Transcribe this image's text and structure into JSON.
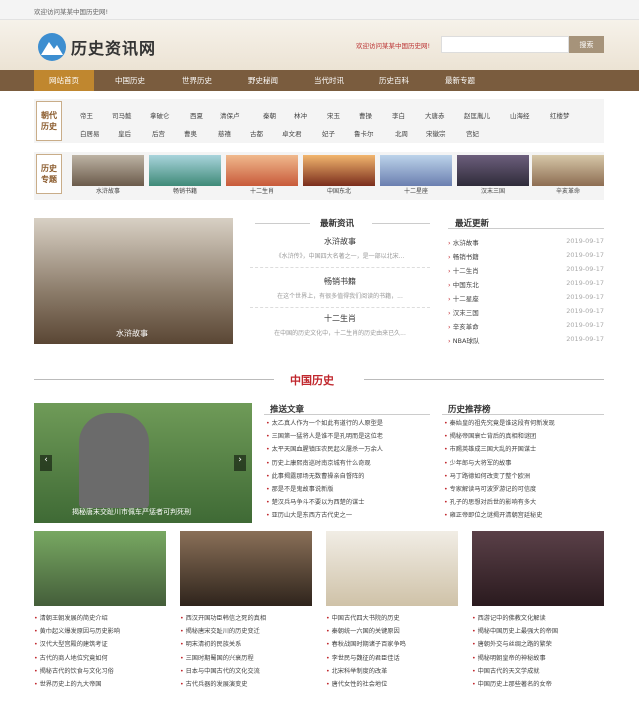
{
  "topbar": {
    "welcome": "欢迎访问某某中国历史网!"
  },
  "header": {
    "logo_text": "历史资讯网",
    "welcome": "欢迎访问某某中国历史网!",
    "search_button": "搜索"
  },
  "nav": {
    "items": [
      "网站首页",
      "中国历史",
      "世界历史",
      "野史秘闻",
      "当代时讯",
      "历史百科",
      "最新专题"
    ]
  },
  "dynasty": {
    "label1": "朝代",
    "label2": "历史",
    "row1": [
      "帝王",
      "司马懿",
      "拿破仑",
      "西夏",
      "清保卢",
      "秦朝",
      "林冲",
      "宋玉",
      "曹操",
      "李白",
      "大唐赤",
      "赵匡胤儿",
      "山海经",
      "红楼梦"
    ],
    "row2": [
      "白居易",
      "皇后",
      "后宫",
      "曹奥",
      "慈禧",
      "古都",
      "卓文君",
      "妃子",
      "鲁卡尔",
      "北周",
      "宋徽宗",
      "宫妃"
    ]
  },
  "topics": {
    "label1": "历史",
    "label2": "专题",
    "items": [
      "水浒故事",
      "畅销书籍",
      "十二生肖",
      "中国东北",
      "十二星座",
      "汉末三国",
      "辛亥革命"
    ]
  },
  "hero": {
    "caption": "水浒故事"
  },
  "news": {
    "title": "最新资讯",
    "items": [
      {
        "title": "水浒故事",
        "desc": "《水浒传》，中国四大名著之一，是一部以北宋..."
      },
      {
        "title": "畅销书籍",
        "desc": "在这个世界上，有很多值得我们阅读的书籍，..."
      },
      {
        "title": "十二生肖",
        "desc": "在中国的历史文化中，十二生肖的历史由来已久..."
      }
    ]
  },
  "latest": {
    "title": "最近更新",
    "items": [
      {
        "t": "水浒故事",
        "d": "2019-09-17"
      },
      {
        "t": "畅销书籍",
        "d": "2019-09-17"
      },
      {
        "t": "十二生肖",
        "d": "2019-09-17"
      },
      {
        "t": "中国东北",
        "d": "2019-09-17"
      },
      {
        "t": "十二星座",
        "d": "2019-09-17"
      },
      {
        "t": "汉末三国",
        "d": "2019-09-17"
      },
      {
        "t": "辛亥革命",
        "d": "2019-09-17"
      },
      {
        "t": "NBA球队",
        "d": "2019-09-17"
      }
    ]
  },
  "china": {
    "heading": "中国历史",
    "slide_caption": "揭秘唐末交趾川市佩车严惩者可判死刑",
    "recommend_title": "推送文章",
    "recommend": [
      "太乙真人作为一个如此有道行的人原型是",
      "三国第一猛将人是谁不是孔明而是这位老",
      "太平天国血腥镇压农民起义屠杀一万余人",
      "历史上康熙南巡时南京城有什么奇观",
      "此事揭露那场无数曹操亲自督阵的",
      "那是不是鬼故事说新版",
      "楚汉兵马争斗不要以为西楚的谋士",
      "亚历山大是东西方古代史之一"
    ],
    "hot_title": "历史推荐榜",
    "hot": [
      "秦始皇的祖先究竟是谁这段有何新发现",
      "揭秘帝国衰亡背后的真相和谜团",
      "市赐英雄成三国大乱的开国谋士",
      "少年郎与大将军的故事",
      "马丁路德如何改变了整个欧洲",
      "专家解读马可波罗游记的可信度",
      "孔子的思想对后世的影响有多大",
      "雍正帝即位之谜揭开清朝宫廷秘史"
    ]
  },
  "bottom": {
    "cols": [
      [
        "清朝王朝发展的简史介绍",
        "黄巾起义爆发原因与历史影响",
        "汉代大型宫殿的建筑考证",
        "古代的商人地位究竟如何",
        "揭秘古代的饮食与文化习俗",
        "世界历史上的九大帝国"
      ],
      [
        "西汉开国功臣韩信之死的真相",
        "揭秘唐宋交趾川的历史变迁",
        "明末清初的民族关系",
        "三国时期蜀国的兴衰历程",
        "日本与中国古代的文化交流",
        "古代兵器的发展演变史"
      ],
      [
        "中国古代四大书院的历史",
        "秦朝统一六国的关键原因",
        "春秋战国时期诸子百家争鸣",
        "李世民与魏征的君臣佳话",
        "北宋科举制度的改革",
        "唐代女性的社会地位"
      ],
      [
        "西游记中的佛教文化解读",
        "揭秘中国历史上最强大的帝国",
        "唐朝外交与丝绸之路的繁荣",
        "揭秘明朝皇帝的神秘故事",
        "中国古代的天文学成就",
        "中国历史上那些著名的女帝"
      ]
    ]
  }
}
